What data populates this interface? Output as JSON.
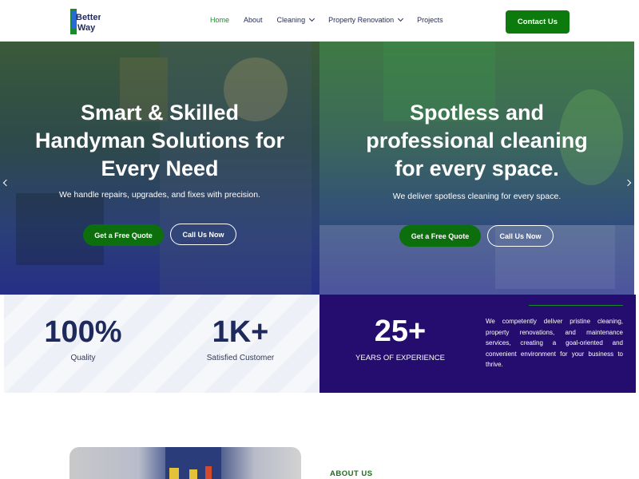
{
  "header": {
    "logo_text": "Better Way",
    "nav": [
      {
        "label": "Home",
        "active": true,
        "has_dropdown": false
      },
      {
        "label": "About",
        "active": false,
        "has_dropdown": false
      },
      {
        "label": "Cleaning",
        "active": false,
        "has_dropdown": true
      },
      {
        "label": "Property Renovation",
        "active": false,
        "has_dropdown": true
      },
      {
        "label": "Projects",
        "active": false,
        "has_dropdown": false
      }
    ],
    "contact_label": "Contact Us"
  },
  "hero": {
    "slides": [
      {
        "title_lines": [
          "Smart & Skilled",
          "Handyman Solutions for",
          "Every Need"
        ],
        "subtitle": "We handle repairs, upgrades, and fixes with precision.",
        "primary_cta": "Get a Free Quote",
        "secondary_cta": "Call Us Now"
      },
      {
        "title_lines": [
          "Spotless and",
          "professional cleaning",
          "for every space."
        ],
        "subtitle": "We deliver spotless cleaning for every space.",
        "primary_cta": "Get a Free Quote",
        "secondary_cta": "Call Us Now"
      }
    ]
  },
  "stats": {
    "quality": {
      "value": "100%",
      "label": "Quality"
    },
    "customers": {
      "value": "1K+",
      "label": "Satisfied Customer"
    },
    "experience": {
      "value": "25+",
      "label": "YEARS OF EXPERIENCE"
    },
    "description": "We competently deliver pristine cleaning, property renovations, and maintenance services, creating a goal-oriented and convenient environment for your business to thrive."
  },
  "about": {
    "label": "ABOUT US"
  },
  "colors": {
    "brand_green": "#0d7a0d",
    "navy": "#1f2a5c",
    "purple_panel": "#240d6e"
  }
}
